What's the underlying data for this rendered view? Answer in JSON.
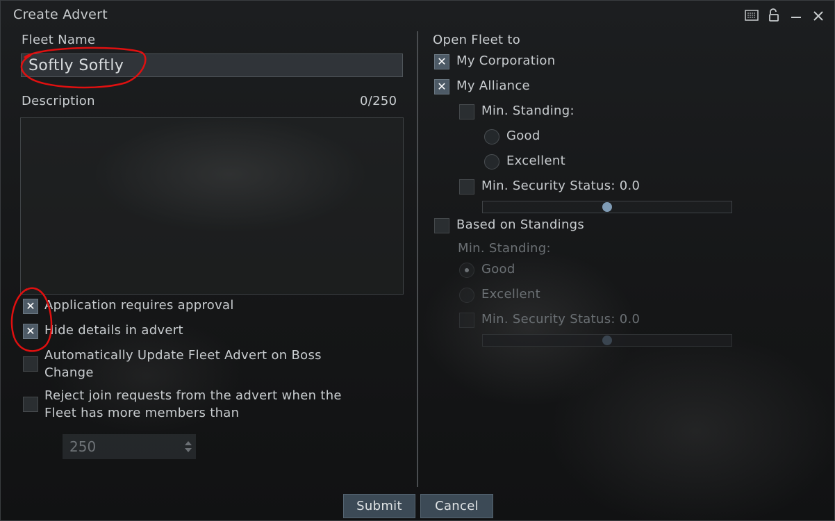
{
  "window": {
    "title": "Create Advert",
    "icons": [
      "compact-mode-icon",
      "unlock-icon",
      "minimize-icon",
      "close-icon"
    ]
  },
  "left": {
    "fleet_name_label": "Fleet Name",
    "fleet_name_value": "Softly Softly",
    "description_label": "Description",
    "description_counter": "0/250",
    "checkboxes": [
      {
        "label": "Application requires approval",
        "checked": true
      },
      {
        "label": "Hide details in advert",
        "checked": true
      },
      {
        "label_line1": "Automatically Update Fleet Advert on Boss",
        "label_line2": "Change",
        "checked": false
      },
      {
        "label_line1": "Reject join requests from the advert when the",
        "label_line2": "Fleet has more members than",
        "checked": false
      }
    ],
    "member_limit_value": "250"
  },
  "right": {
    "open_fleet_label": "Open Fleet to",
    "my_corporation": {
      "label": "My Corporation",
      "checked": true
    },
    "my_alliance": {
      "label": "My Alliance",
      "checked": true
    },
    "alliance_min_standing": {
      "label": "Min. Standing:",
      "checked": false
    },
    "alliance_standing_options": [
      "Good",
      "Excellent"
    ],
    "alliance_min_security": {
      "label": "Min. Security Status: 0.0",
      "checked": false
    },
    "based_on_standings": {
      "label": "Based on Standings",
      "checked": false
    },
    "standings_min_standing_label": "Min. Standing:",
    "standings_options": [
      {
        "label": "Good",
        "selected": true
      },
      {
        "label": "Excellent",
        "selected": false
      }
    ],
    "standings_min_security": {
      "label": "Min. Security Status: 0.0",
      "checked": false
    }
  },
  "footer": {
    "submit_label": "Submit",
    "cancel_label": "Cancel"
  },
  "colors": {
    "accent_checked": "#4d5a66",
    "button_bg": "#3c4a56",
    "annotation": "#e01010",
    "slider_thumb": "#7f9bb5"
  }
}
